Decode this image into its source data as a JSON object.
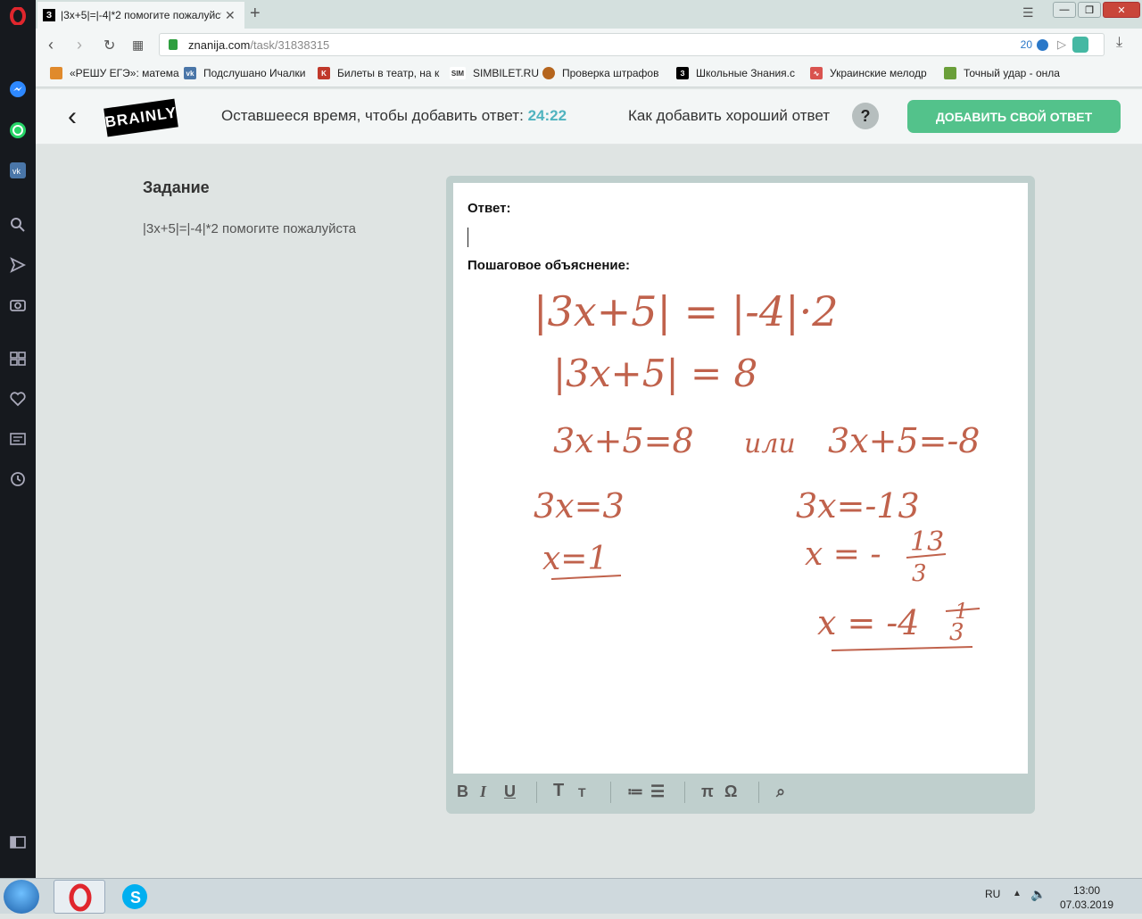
{
  "browser": {
    "tab_title": "|3x+5|=|-4|*2 помогите пожалуйста",
    "tab_favicon": "З",
    "new_tab": "+",
    "url_host": "znanija.com",
    "url_path": "/task/31838315",
    "adblock_count": "20",
    "bookmarks": [
      {
        "label": "«РЕШУ ЕГЭ»: матема",
        "icon": "sun-icon",
        "color": "#e08a2c"
      },
      {
        "label": "Подслушано Ичалки",
        "icon": "vk-icon",
        "color": "#4a76a8"
      },
      {
        "label": "Билеты в театр, на к",
        "icon": "k-icon",
        "color": "#c0392b"
      },
      {
        "label": "SIMBILET.RU",
        "icon": "sim-icon",
        "color": "#333333"
      },
      {
        "label": "Проверка штрафов",
        "icon": "emblem-icon",
        "color": "#b5651d"
      },
      {
        "label": "Школьные Знания.c",
        "icon": "znanija-icon",
        "color": "#000000"
      },
      {
        "label": "Украинские мелодр",
        "icon": "chart-icon",
        "color": "#d9534f"
      },
      {
        "label": "Точный удар - онла",
        "icon": "game-icon",
        "color": "#6a9f3a"
      }
    ]
  },
  "header": {
    "logo": "BRAINLY",
    "timer_label": "Оставшееся время, чтобы добавить ответ:",
    "timer_value": "24:22",
    "howto": "Как добавить хороший ответ",
    "help": "?",
    "add_answer": "ДОБАВИТЬ СВОЙ ОТВЕТ"
  },
  "task": {
    "heading": "Задание",
    "text": "|3x+5|=|-4|*2 помогите пожалуйста"
  },
  "editor": {
    "answer_label": "Ответ:",
    "explanation_label": "Пошаговое объяснение:",
    "handwriting": {
      "line1": "|3x+5| = |-4|·2",
      "line2": "|3x+5| = 8",
      "line3a": "3x+5=8",
      "line3b": "или",
      "line3c": "3x+5=-8",
      "l_a": "3x=3",
      "l_b": "x=1",
      "r_a": "3x=-13",
      "r_b": "x = -",
      "r_b_num": "13",
      "r_b_den": "3",
      "r_c": "x = -4",
      "r_c_num": "1",
      "r_c_den": "3"
    },
    "toolbar": {
      "bold": "B",
      "italic": "I",
      "underline": "U",
      "heading_big": "T",
      "heading_small": "T",
      "pi": "π",
      "omega": "Ω"
    }
  },
  "taskbar": {
    "lang": "RU",
    "time": "13:00",
    "date": "07.03.2019"
  }
}
